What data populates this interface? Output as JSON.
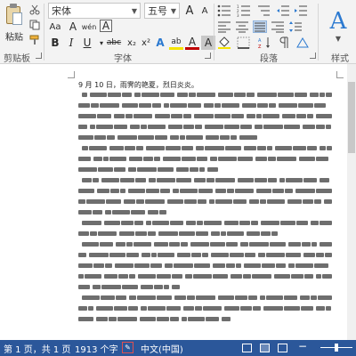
{
  "ribbon": {
    "paste_label": "粘贴",
    "clipboard_label": "剪贴板",
    "font_group_label": "字体",
    "paragraph_group_label": "段落",
    "styles_group_label": "样式",
    "font_name": "宋体",
    "font_size": "五号",
    "grow_font": "A",
    "shrink_font": "A",
    "change_case": "Aa",
    "clear_format": "A",
    "phonetic": "wén",
    "char_border": "A",
    "bold": "B",
    "italic": "I",
    "underline": "U",
    "strikethrough": "abc",
    "subscript": "x₂",
    "superscript": "x²",
    "text_effects": "A",
    "highlight": "ab",
    "font_color": "A",
    "char_shading": "A",
    "enclose": "字",
    "style_preview": "A"
  },
  "document": {
    "date_line": "9 月 10 日，雨霁的艳夏，烈日炎炎。"
  },
  "status": {
    "page": "第 1 页，共 1 页",
    "words": "1913 个字",
    "language": "中文(中国)"
  },
  "colors": {
    "highlight": "#f5e400",
    "font_color": "#c00000",
    "statusbar": "#2b579a"
  }
}
